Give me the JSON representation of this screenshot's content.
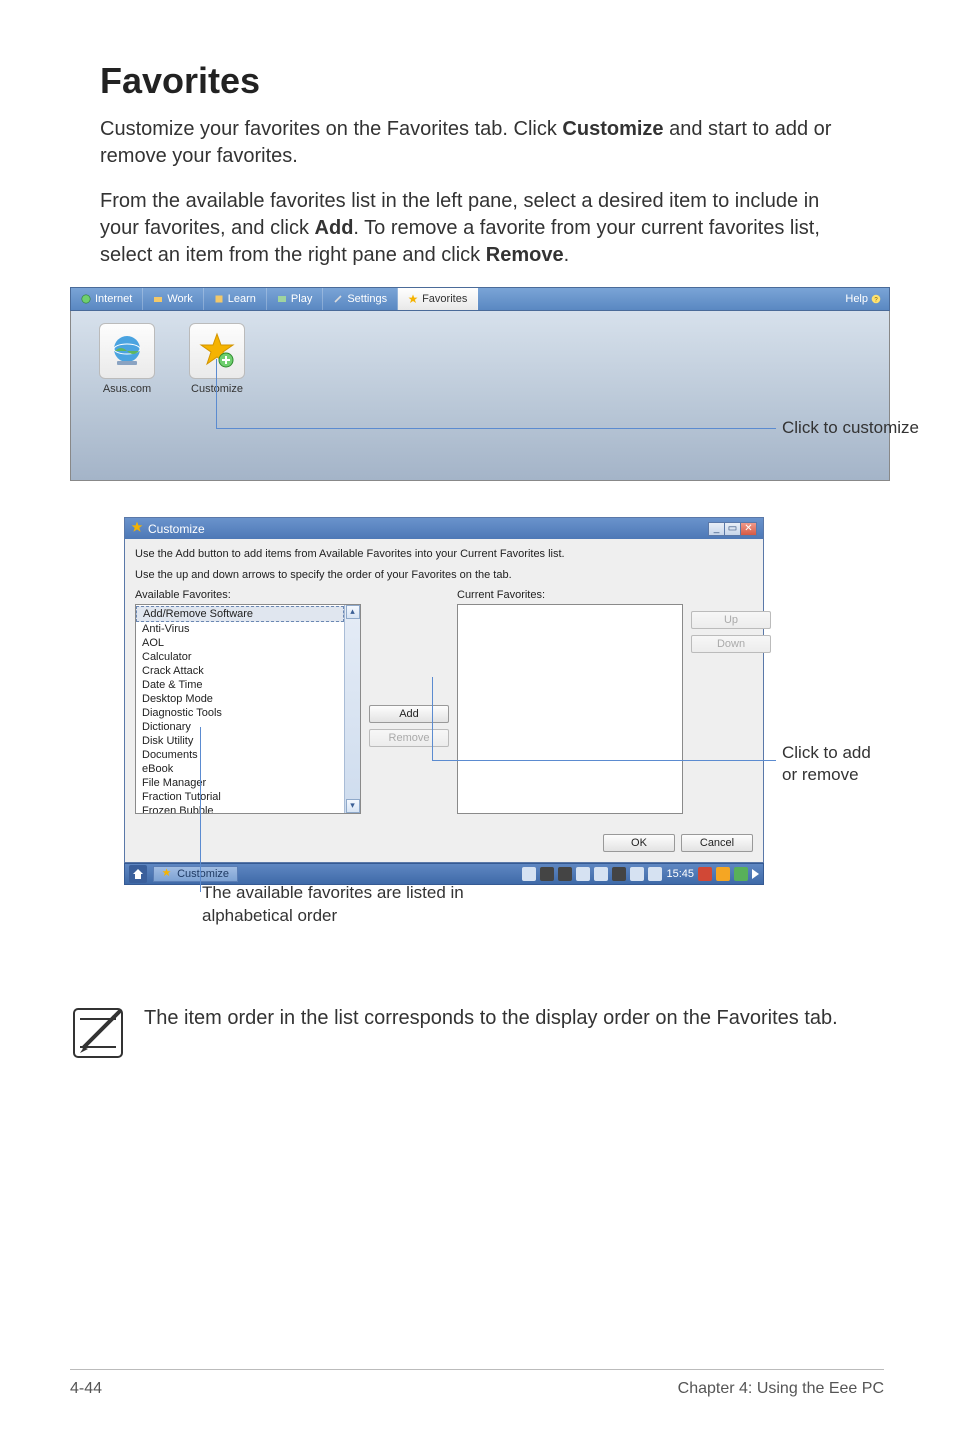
{
  "heading": "Favorites",
  "para1_pre": "Customize your favorites on the Favorites tab. Click ",
  "para1_bold": "Customize",
  "para1_post": " and start to add or remove your favorites.",
  "para2_a": "From the available favorites list in the left pane, select a desired item to include in your favorites, and click ",
  "para2_add": "Add",
  "para2_b": ". To remove a favorite from your current favorites list, select an item from the right pane and click ",
  "para2_rem": "Remove",
  "para2_c": ".",
  "tabs": {
    "internet": "Internet",
    "work": "Work",
    "learn": "Learn",
    "play": "Play",
    "settings": "Settings",
    "favorites": "Favorites",
    "help": "Help"
  },
  "desk": {
    "asus": "Asus.com",
    "customize": "Customize"
  },
  "callout1": "Click to customize",
  "dialog": {
    "title": "Customize",
    "inst1": "Use the Add button to add items from Available Favorites into your Current Favorites list.",
    "inst2": "Use the up and down arrows to specify the order of your Favorites on the tab.",
    "avail_label": "Available Favorites:",
    "curr_label": "Current Favorites:",
    "avail_items": [
      "Add/Remove Software",
      "Anti-Virus",
      "AOL",
      "Calculator",
      "Crack Attack",
      "Date & Time",
      "Desktop Mode",
      "Diagnostic Tools",
      "Dictionary",
      "Disk Utility",
      "Documents",
      "eBook",
      "File Manager",
      "Fraction Tutorial",
      "Frozen Bubble"
    ],
    "add": "Add",
    "remove": "Remove",
    "up": "Up",
    "down": "Down",
    "ok": "OK",
    "cancel": "Cancel"
  },
  "taskbar": {
    "app": "Customize",
    "time": "15:45"
  },
  "callout2": "Click to add or remove",
  "callout3": "The available favorites are listed in alphabetical order",
  "note": "The item order in the list corresponds to the display order on the Favorites tab.",
  "footer_left": "4-44",
  "footer_right": "Chapter 4: Using the Eee PC"
}
